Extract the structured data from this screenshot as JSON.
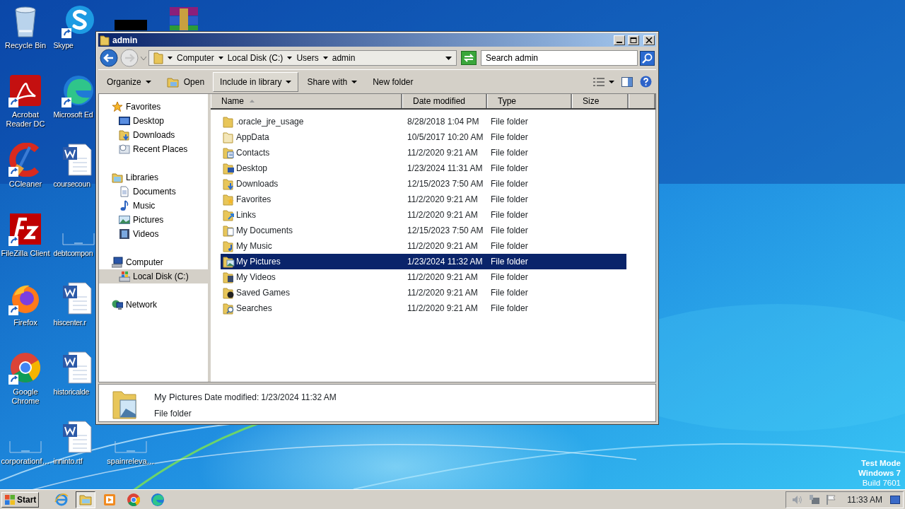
{
  "desktop_icons": [
    {
      "kind": "recycle",
      "label": "Recycle Bin",
      "shortcut": false
    },
    {
      "kind": "skype",
      "label": "Skype",
      "shortcut": true
    },
    {
      "kind": "black",
      "shortcut": false
    },
    {
      "kind": "winrar",
      "shortcut": false
    },
    {
      "kind": "acrobat",
      "label": "Acrobat Reader DC",
      "shortcut": true
    },
    {
      "kind": "edge",
      "label": "Microsoft Ed",
      "shortcut": true
    },
    {
      "kind": "ccleaner",
      "label": "CCleaner",
      "shortcut": true
    },
    {
      "kind": "word",
      "label": "coursecoun",
      "shortcut": false
    },
    {
      "kind": "filezilla",
      "label": "FileZilla Client",
      "shortcut": true
    },
    {
      "kind": "blank",
      "label": "debtcompon",
      "shortcut": false
    },
    {
      "kind": "firefox",
      "label": "Firefox",
      "shortcut": true
    },
    {
      "kind": "word",
      "label": "hiscenter.r",
      "shortcut": false
    },
    {
      "kind": "chrome",
      "label": "Google Chrome",
      "shortcut": true
    },
    {
      "kind": "word",
      "label": "historicalde",
      "shortcut": false
    },
    {
      "kind": "blank",
      "label": "corporationf…",
      "shortcut": false
    },
    {
      "kind": "word",
      "label": "inninto.rtf",
      "shortcut": false
    },
    {
      "kind": "blank",
      "label": "spainreleva…",
      "shortcut": false
    }
  ],
  "window": {
    "title": "admin"
  },
  "address": {
    "crumbs": [
      "Computer",
      "Local Disk (C:)",
      "Users",
      "admin"
    ]
  },
  "search": {
    "placeholder": "Search admin"
  },
  "toolbar": [
    {
      "label": "Organize",
      "kind": "dropdown",
      "highlighted": false
    },
    {
      "label": "Open",
      "kind": "open",
      "highlighted": false
    },
    {
      "label": "Include in library",
      "kind": "dropdown",
      "highlighted": true
    },
    {
      "label": "Share with",
      "kind": "dropdown",
      "highlighted": false
    },
    {
      "label": "New folder",
      "kind": "plain",
      "highlighted": false
    }
  ],
  "nav": [
    {
      "label": "Favorites",
      "kind": "star",
      "selected": false,
      "children": [
        {
          "label": "Desktop",
          "kind": "desktop",
          "selected": false
        },
        {
          "label": "Downloads",
          "kind": "downloads",
          "selected": false
        },
        {
          "label": "Recent Places",
          "kind": "recent",
          "selected": false
        }
      ]
    },
    {
      "label": "Libraries",
      "kind": "library",
      "selected": false,
      "children": [
        {
          "label": "Documents",
          "kind": "documents",
          "selected": false
        },
        {
          "label": "Music",
          "kind": "music",
          "selected": false
        },
        {
          "label": "Pictures",
          "kind": "pictures",
          "selected": false
        },
        {
          "label": "Videos",
          "kind": "videos",
          "selected": false
        }
      ]
    },
    {
      "label": "Computer",
      "kind": "computer",
      "selected": false,
      "children": [
        {
          "label": "Local Disk (C:)",
          "kind": "disk",
          "selected": true
        }
      ]
    },
    {
      "label": "Network",
      "kind": "network",
      "selected": false
    }
  ],
  "columns": [
    {
      "label": "Name",
      "sorted": true
    },
    {
      "label": "Date modified",
      "sorted": false
    },
    {
      "label": "Type",
      "sorted": false
    },
    {
      "label": "Size",
      "sorted": false
    }
  ],
  "rows": [
    {
      "name": ".oracle_jre_usage",
      "date": "8/28/2018 1:04 PM",
      "type": "File folder",
      "kind": "plain",
      "selected": false
    },
    {
      "name": "AppData",
      "date": "10/5/2017 10:20 AM",
      "type": "File folder",
      "kind": "hidden",
      "selected": false
    },
    {
      "name": "Contacts",
      "date": "11/2/2020 9:21 AM",
      "type": "File folder",
      "kind": "contacts",
      "selected": false
    },
    {
      "name": "Desktop",
      "date": "1/23/2024 11:31 AM",
      "type": "File folder",
      "kind": "desktop",
      "selected": false
    },
    {
      "name": "Downloads",
      "date": "12/15/2023 7:50 AM",
      "type": "File folder",
      "kind": "downloads",
      "selected": false
    },
    {
      "name": "Favorites",
      "date": "11/2/2020 9:21 AM",
      "type": "File folder",
      "kind": "favorites",
      "selected": false
    },
    {
      "name": "Links",
      "date": "11/2/2020 9:21 AM",
      "type": "File folder",
      "kind": "links",
      "selected": false
    },
    {
      "name": "My Documents",
      "date": "12/15/2023 7:50 AM",
      "type": "File folder",
      "kind": "documents",
      "selected": false
    },
    {
      "name": "My Music",
      "date": "11/2/2020 9:21 AM",
      "type": "File folder",
      "kind": "music",
      "selected": false
    },
    {
      "name": "My Pictures",
      "date": "1/23/2024 11:32 AM",
      "type": "File folder",
      "kind": "pictures",
      "selected": true
    },
    {
      "name": "My Videos",
      "date": "11/2/2020 9:21 AM",
      "type": "File folder",
      "kind": "videos",
      "selected": false
    },
    {
      "name": "Saved Games",
      "date": "11/2/2020 9:21 AM",
      "type": "File folder",
      "kind": "games",
      "selected": false
    },
    {
      "name": "Searches",
      "date": "11/2/2020 9:21 AM",
      "type": "File folder",
      "kind": "searches",
      "selected": false
    }
  ],
  "details": {
    "name": "My Pictures",
    "date_label": "Date modified:",
    "date": "1/23/2024 11:32 AM",
    "type": "File folder"
  },
  "desktop_notice": [
    {
      "text": "Test Mode",
      "bold": true
    },
    {
      "text": "Windows 7",
      "bold": true
    },
    {
      "text": "Build 7601",
      "bold": false
    }
  ],
  "taskbar": {
    "start": "Start",
    "apps": [
      {
        "kind": "ie",
        "selected": false
      },
      {
        "kind": "explorer",
        "selected": true
      },
      {
        "kind": "media",
        "selected": false
      },
      {
        "kind": "chrome",
        "selected": false
      },
      {
        "kind": "edge",
        "selected": false
      }
    ],
    "clock": "11:33 AM"
  }
}
